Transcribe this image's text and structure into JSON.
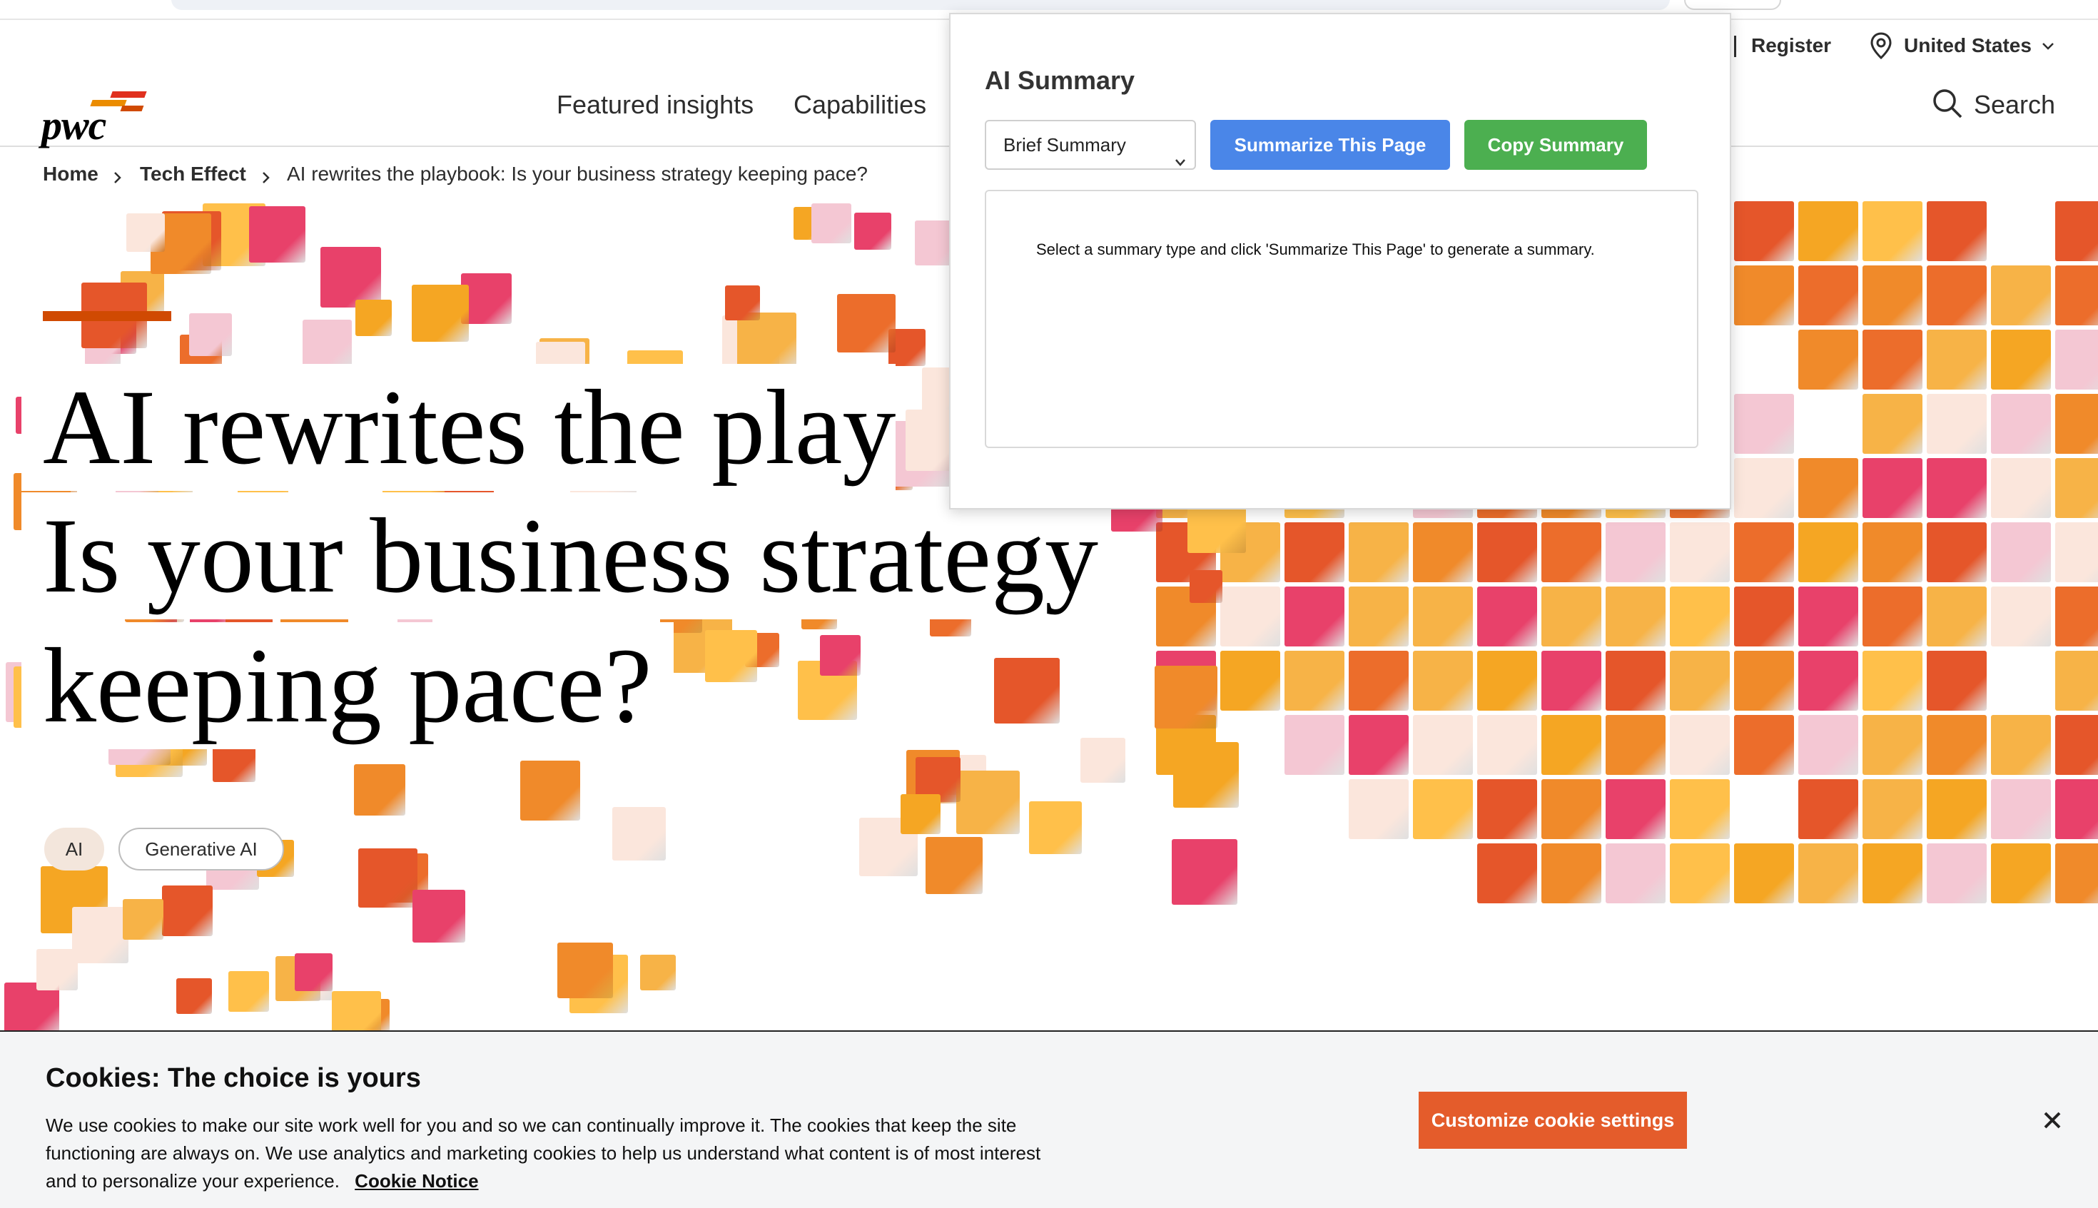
{
  "header": {
    "logo_text": "pwc",
    "util_nav": {
      "register": "Register",
      "region": "United States"
    },
    "main_nav": [
      "Featured insights",
      "Capabilities"
    ],
    "search_label": "Search"
  },
  "breadcrumb": {
    "home": "Home",
    "section": "Tech Effect",
    "current": "AI rewrites the playbook: Is your business strategy keeping pace?"
  },
  "hero": {
    "title_lines": [
      "AI rewrites the play",
      "Is your business strategy",
      "keeping pace?"
    ],
    "tags": [
      "AI",
      "Generative AI"
    ]
  },
  "ai_panel": {
    "title": "AI Summary",
    "summary_type_selected": "Brief Summary",
    "summarize_button": "Summarize This Page",
    "copy_button": "Copy Summary",
    "output_text": "Select a summary type and click 'Summarize This Page' to generate a summary.",
    "colors": {
      "summarize": "#4a86e8",
      "copy": "#4caf50"
    }
  },
  "cookie_banner": {
    "title": "Cookies: The choice is yours",
    "body": "We use cookies to make our site work well for you and so we can continually improve it. The cookies that keep the site functioning are always on. We use analytics and marketing cookies to help us understand what content is of most interest and to personalize your experience.",
    "link": "Cookie Notice",
    "customize_button": "Customize cookie settings"
  },
  "icons": [
    "location-pin-icon",
    "chevron-down-icon",
    "search-icon",
    "chevron-right-icon",
    "close-icon"
  ],
  "colors": {
    "brand_orange": "#d04a02",
    "cookie_button": "#e45c2b",
    "pink": "#e8416a",
    "amber": "#f5a623"
  }
}
